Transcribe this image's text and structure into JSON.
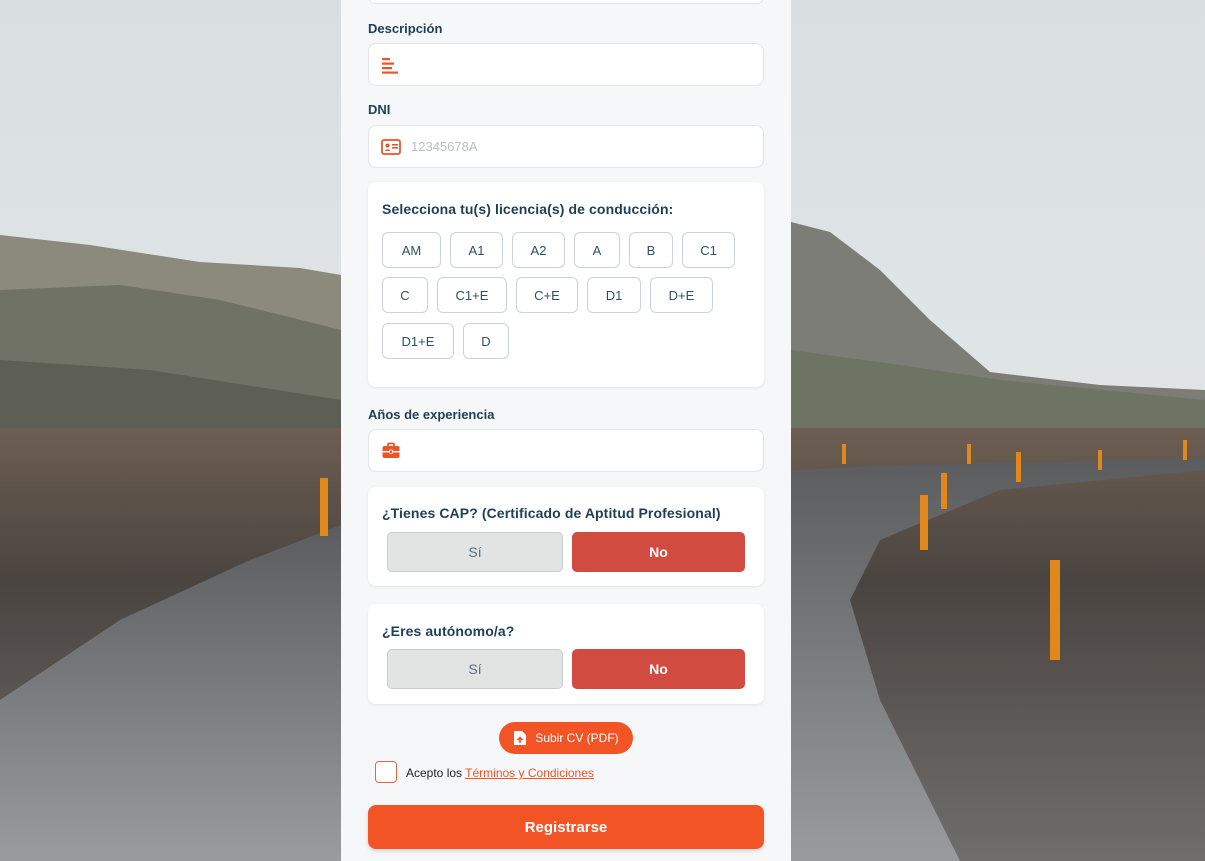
{
  "colors": {
    "accent": "#f25426",
    "no_selected": "#d14b40",
    "label": "#1f3f56"
  },
  "form": {
    "description": {
      "label": "Descripción",
      "placeholder": "",
      "icon": "align-left-icon"
    },
    "dni": {
      "label": "DNI",
      "placeholder": "12345678A",
      "icon": "id-card-icon"
    },
    "licenses": {
      "title": "Selecciona tu(s) licencia(s) de conducción:",
      "options": [
        "AM",
        "A1",
        "A2",
        "A",
        "B",
        "C1",
        "C",
        "C1+E",
        "C+E",
        "D1",
        "D+E",
        "D1+E",
        "D"
      ]
    },
    "experience": {
      "label": "Años de experiencia",
      "placeholder": "",
      "icon": "briefcase-icon"
    },
    "cap": {
      "question": "¿Tienes CAP? (Certificado de Aptitud Profesional)",
      "yes": "Sí",
      "no": "No",
      "selected": "No"
    },
    "autonomo": {
      "question": "¿Eres autónomo/a?",
      "yes": "Sí",
      "no": "No",
      "selected": "No"
    },
    "upload": {
      "label": "Subir CV (PDF)",
      "icon": "file-upload-icon"
    },
    "terms": {
      "prefix": "Acepto los",
      "link": "Términos y Condiciones",
      "checked": false
    },
    "submit": "Registrarse"
  }
}
